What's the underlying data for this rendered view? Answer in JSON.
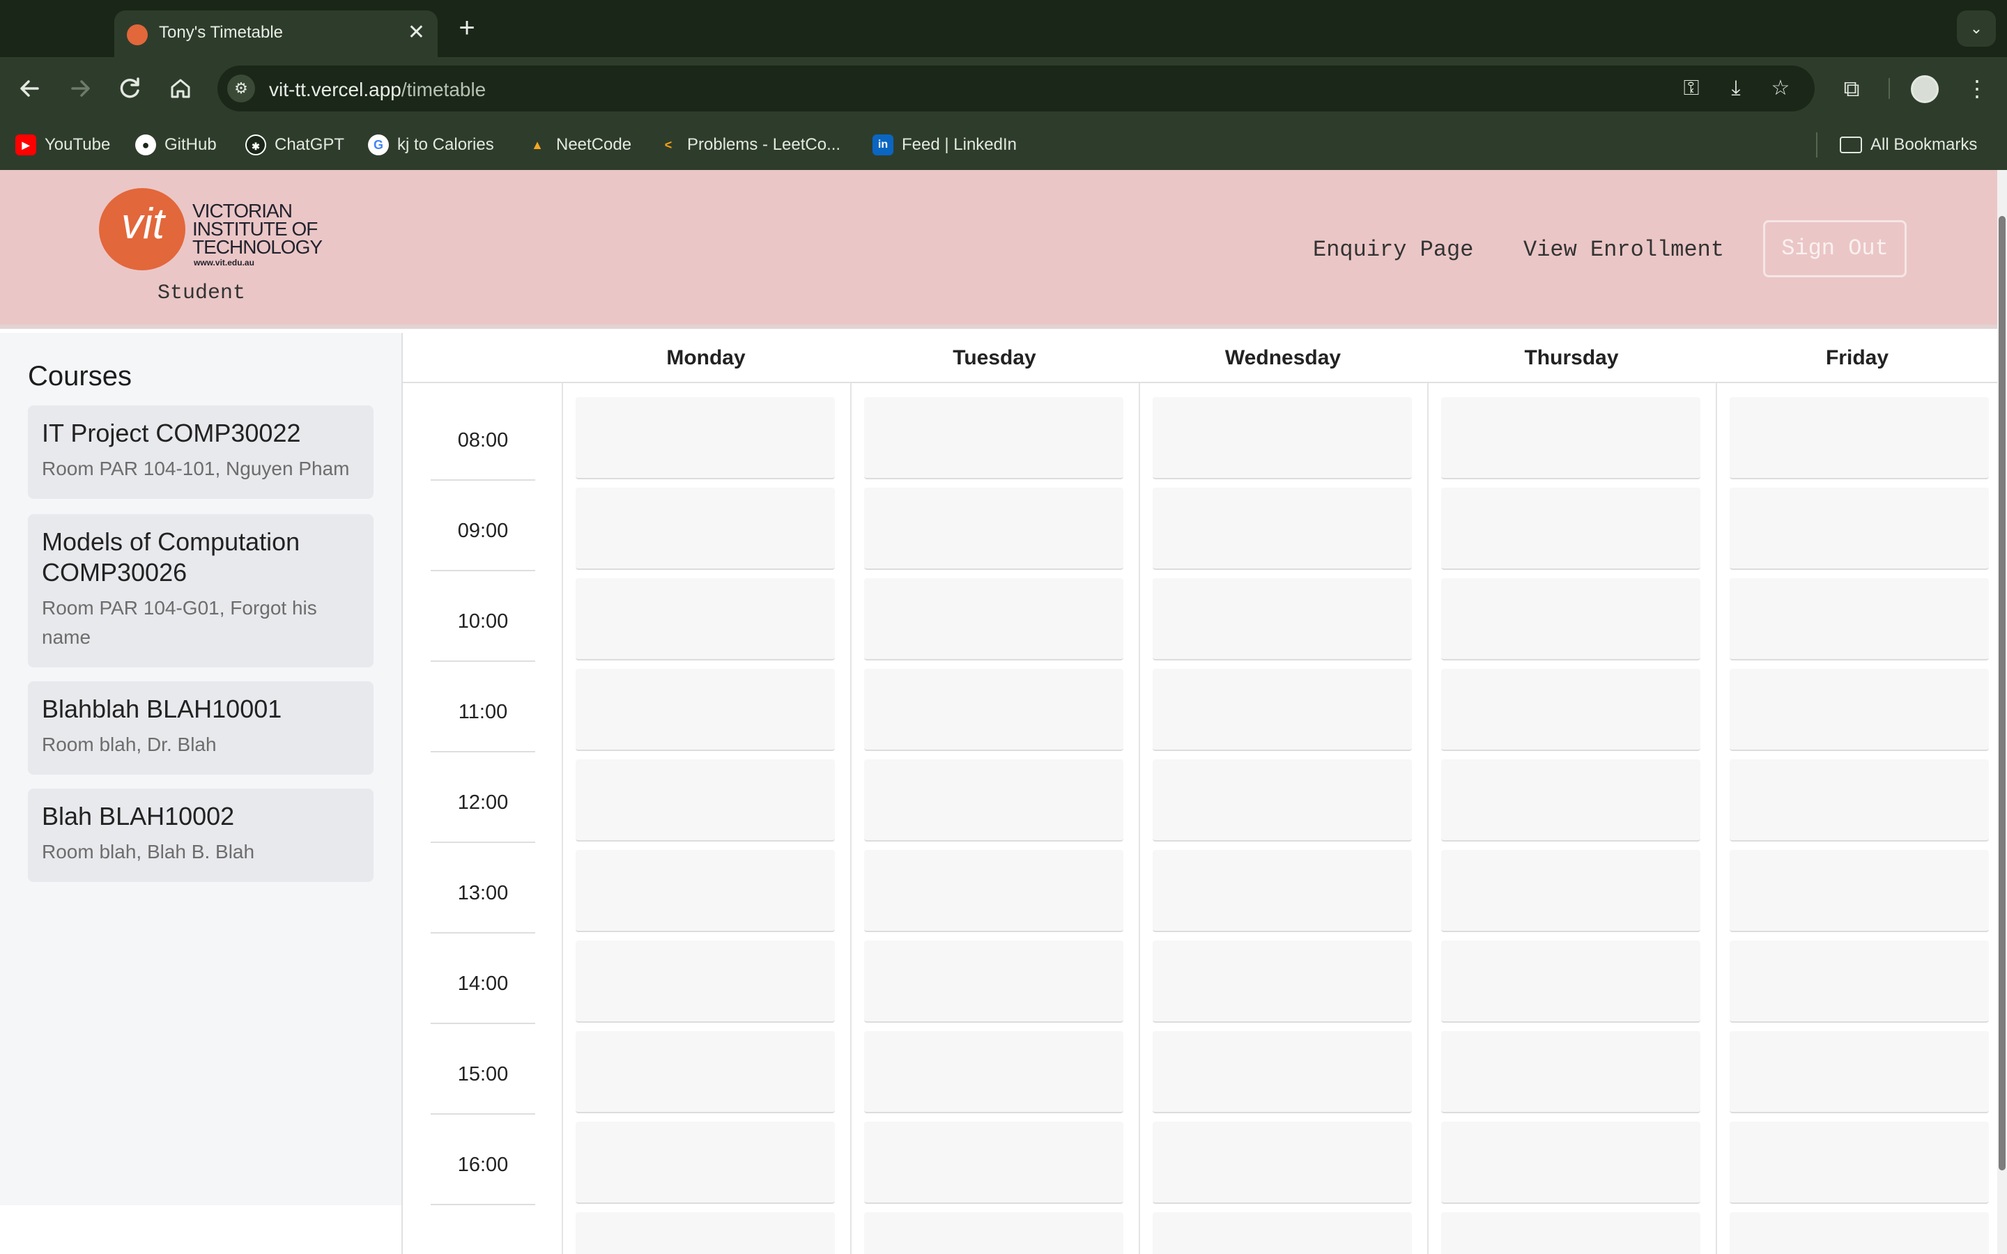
{
  "browser": {
    "tab_title": "Tony's Timetable",
    "tab_close": "✕",
    "new_tab": "+",
    "tab_menu": "⌄",
    "url_host": "vit-tt.vercel.app",
    "url_path": "/timetable",
    "bookmarks": [
      {
        "label": "YouTube",
        "icon": "youtube-icon",
        "color": "#ff0000"
      },
      {
        "label": "GitHub",
        "icon": "github-icon",
        "color": "#ffffff"
      },
      {
        "label": "ChatGPT",
        "icon": "chatgpt-icon",
        "color": "#ffffff"
      },
      {
        "label": "kj to Calories",
        "icon": "google-icon",
        "color": "#4285f4"
      },
      {
        "label": "NeetCode",
        "icon": "rocket-icon",
        "color": "#f5a623"
      },
      {
        "label": "Problems - LeetCo...",
        "icon": "leetcode-icon",
        "color": "#ffa116"
      },
      {
        "label": "Feed | LinkedIn",
        "icon": "linkedin-icon",
        "color": "#0a66c2"
      }
    ],
    "all_bookmarks": "All Bookmarks"
  },
  "header": {
    "logo_text": [
      "VICTORIAN",
      "INSTITUTE OF",
      "TECHNOLOGY"
    ],
    "logo_url": "www.vit.edu.au",
    "logo_mark": "vit",
    "role": "Student",
    "nav": {
      "enquiry": "Enquiry Page",
      "enrollment": "View Enrollment",
      "signout": "Sign Out"
    },
    "background": "#ebc6c6",
    "brand_color": "#e2673b"
  },
  "sidebar": {
    "title": "Courses",
    "courses": [
      {
        "name": "IT Project COMP30022",
        "detail": "Room PAR 104-101, Nguyen Pham"
      },
      {
        "name": "Models of Computation COMP30026",
        "detail": "Room PAR 104-G01, Forgot his name"
      },
      {
        "name": "Blahblah BLAH10001",
        "detail": "Room blah, Dr. Blah"
      },
      {
        "name": "Blah BLAH10002",
        "detail": "Room blah, Blah B. Blah"
      }
    ]
  },
  "timetable": {
    "days": [
      "Monday",
      "Tuesday",
      "Wednesday",
      "Thursday",
      "Friday"
    ],
    "times": [
      "08:00",
      "09:00",
      "10:00",
      "11:00",
      "12:00",
      "13:00",
      "14:00",
      "15:00",
      "16:00"
    ]
  }
}
